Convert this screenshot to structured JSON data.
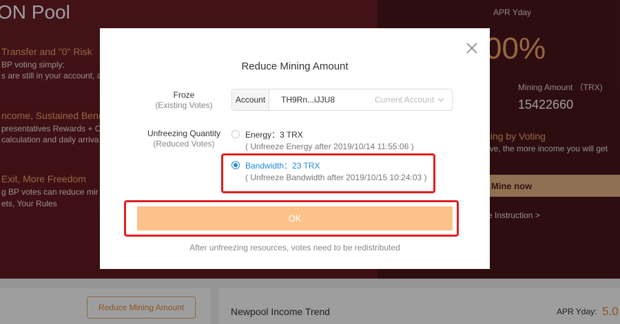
{
  "background": {
    "pool_title": "ON Pool",
    "features": [
      {
        "title": "Transfer and \"0\" Risk",
        "lines": [
          "BP voting simply;",
          "s are still in your account, a"
        ]
      },
      {
        "title": "ncome, Sustained Bene",
        "lines": [
          "presentatives Rewards + C",
          "calculation and daily arriva"
        ]
      },
      {
        "title": "Exit, More Freedom",
        "lines": [
          "g BP votes can reduce mir",
          "ets, Your Rules"
        ]
      }
    ],
    "apr_label": "APR Yday",
    "apr_value": "00%",
    "mining_amount_label": "Mining Amount （TRX)",
    "mining_amount_value": "15422660",
    "voting_title": "ning by Voting",
    "voting_desc": "ave, the more income you will get",
    "mine_now": "Mine now",
    "instruction_link": "re Instruction >",
    "reduce_button": "Reduce Mining Amount",
    "trend_title": "Newpool Income Trend",
    "apr_yday_bottom_label": "APR Yday:",
    "apr_yday_bottom_value": "5.0"
  },
  "modal": {
    "title": "Reduce Mining Amount",
    "froze_label": "Froze",
    "froze_sub": "(Existing Votes)",
    "account_label": "Account",
    "account_value": "TH9Rn...iJJU8",
    "account_select": "Current Account",
    "unfreeze_label": "Unfreezing Quantity",
    "unfreeze_sub": "(Reduced Votes)",
    "options": [
      {
        "label": "Energy：3 TRX",
        "note": "( Unfreeze Energy after 2019/10/14 11:55:06 )",
        "selected": false
      },
      {
        "label": "Bandwidth：23 TRX",
        "note": "( Unfreeze Bandwidth after 2019/10/15 10:24:03 )",
        "selected": true
      }
    ],
    "ok_label": "OK",
    "hint": "After unfreezing resources, votes need to be redistributed"
  },
  "colors": {
    "accent": "#fcc289",
    "selected": "#1e88e5",
    "highlight_frame": "#e02020",
    "brand_dark": "#5a1c22"
  }
}
